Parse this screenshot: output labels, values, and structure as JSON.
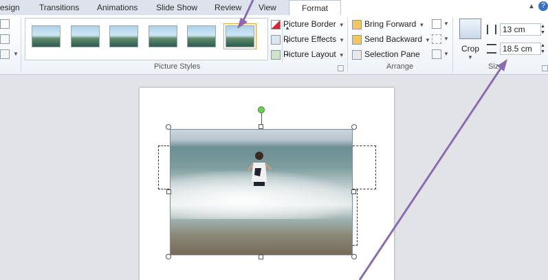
{
  "tabs": {
    "items": [
      "esign",
      "Transitions",
      "Animations",
      "Slide Show",
      "Review",
      "View"
    ],
    "active": "Format"
  },
  "ribbon": {
    "picture_styles": {
      "label": "Picture Styles",
      "commands": [
        "Picture Border",
        "Picture Effects",
        "Picture Layout"
      ]
    },
    "arrange": {
      "label": "Arrange",
      "commands": [
        "Bring Forward",
        "Send Backward",
        "Selection Pane"
      ]
    },
    "size": {
      "label": "Siz",
      "crop_label": "Crop",
      "height_value": "13 cm",
      "width_value": "18.5 cm"
    }
  },
  "colors": {
    "annotation_arrow": "#8a6bb1",
    "rotation_handle": "#6fd05a",
    "accent_tab_border": "#b9c3d0"
  }
}
